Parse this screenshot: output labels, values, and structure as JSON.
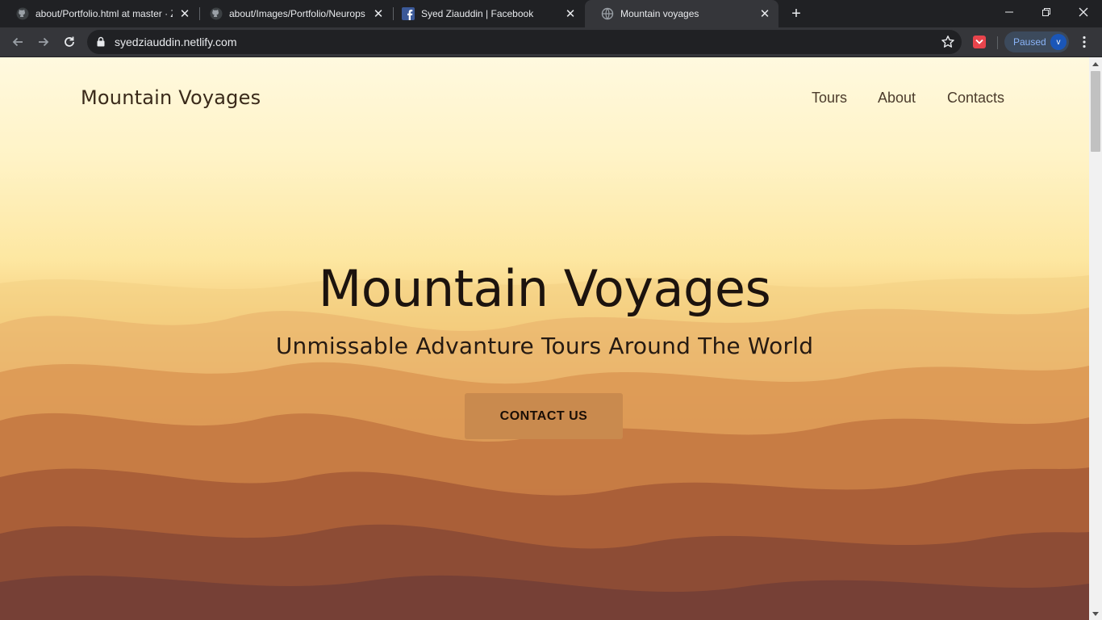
{
  "browser": {
    "tabs": [
      {
        "title": "about/Portfolio.html at master · Z",
        "icon": "github-icon"
      },
      {
        "title": "about/Images/Portfolio/Neurops",
        "icon": "github-icon"
      },
      {
        "title": "Syed Ziauddin | Facebook",
        "icon": "facebook-icon"
      },
      {
        "title": "Mountain voyages",
        "icon": "globe-icon",
        "active": true
      }
    ],
    "new_tab": "+",
    "url": "syedziauddin.netlify.com",
    "profile": {
      "label": "Paused",
      "initial": "v"
    }
  },
  "site": {
    "brand": "Mountain Voyages",
    "nav": [
      "Tours",
      "About",
      "Contacts"
    ],
    "headline": "Mountain Voyages",
    "subheadline": "Unmissable Advanture Tours Around The World",
    "cta": "CONTACT US"
  },
  "colors": {
    "cta_background": "#c98a4e",
    "browser_dark": "#202124",
    "toolbar": "#35363a"
  }
}
